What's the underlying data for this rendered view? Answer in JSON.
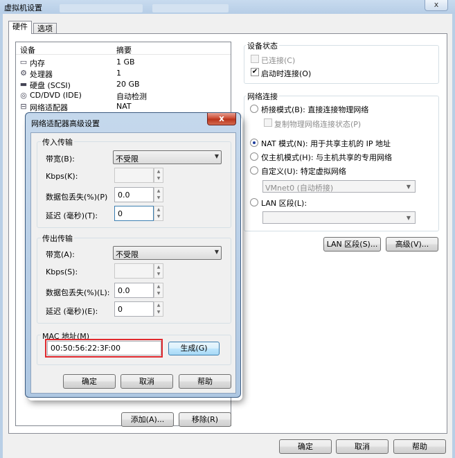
{
  "window": {
    "title": "虚拟机设置",
    "close_label": "x"
  },
  "tabs": [
    {
      "label": "硬件"
    },
    {
      "label": "选项"
    }
  ],
  "device_list": {
    "headers": {
      "device": "设备",
      "summary": "摘要"
    },
    "rows": [
      {
        "icon": "memory-icon",
        "name": "内存",
        "summary": "1 GB"
      },
      {
        "icon": "cpu-icon",
        "name": "处理器",
        "summary": "1"
      },
      {
        "icon": "disk-icon",
        "name": "硬盘 (SCSI)",
        "summary": "20 GB"
      },
      {
        "icon": "cdrom-icon",
        "name": "CD/DVD (IDE)",
        "summary": "自动检测"
      },
      {
        "icon": "network-icon",
        "name": "网络适配器",
        "summary": "NAT"
      }
    ]
  },
  "device_status": {
    "label": "设备状态",
    "connected": {
      "label": "已连接(C)",
      "checked": false,
      "enabled": false
    },
    "connect_at_power_on": {
      "label": "启动时连接(O)",
      "checked": true
    }
  },
  "network_connection": {
    "label": "网络连接",
    "bridged": {
      "label": "桥接模式(B): 直接连接物理网络",
      "selected": false
    },
    "replicate": {
      "label": "复制物理网络连接状态(P)",
      "checked": false,
      "enabled": false
    },
    "nat": {
      "label": "NAT 模式(N): 用于共享主机的 IP 地址",
      "selected": true
    },
    "host_only": {
      "label": "仅主机模式(H): 与主机共享的专用网络",
      "selected": false
    },
    "custom": {
      "label": "自定义(U): 特定虚拟网络",
      "selected": false
    },
    "custom_select": "VMnet0 (自动桥接)",
    "lan_segment": {
      "label": "LAN 区段(L):",
      "selected": false
    },
    "lan_select": ""
  },
  "right_buttons": {
    "lan_segments": "LAN 区段(S)...",
    "advanced": "高级(V)..."
  },
  "list_buttons": {
    "add": "添加(A)...",
    "remove": "移除(R)"
  },
  "bottom_buttons": {
    "ok": "确定",
    "cancel": "取消",
    "help": "帮助"
  },
  "dialog": {
    "title": "网络适配器高级设置",
    "close_label": "x",
    "incoming": {
      "label": "传入传输",
      "bandwidth_label": "带宽(B):",
      "bandwidth_value": "不受限",
      "kbps_label": "Kbps(K):",
      "kbps_value": "",
      "loss_label": "数据包丢失(%)(P)",
      "loss_value": "0.0",
      "latency_label": "延迟 (毫秒)(T):",
      "latency_value": "0"
    },
    "outgoing": {
      "label": "传出传输",
      "bandwidth_label": "带宽(A):",
      "bandwidth_value": "不受限",
      "kbps_label": "Kbps(S):",
      "kbps_value": "",
      "loss_label": "数据包丢失(%)(L):",
      "loss_value": "0.0",
      "latency_label": "延迟 (毫秒)(E):",
      "latency_value": "0"
    },
    "mac": {
      "label": "MAC 地址(M)",
      "value": "00:50:56:22:3F:00",
      "generate": "生成(G)"
    },
    "buttons": {
      "ok": "确定",
      "cancel": "取消",
      "help": "帮助"
    }
  },
  "colors": {
    "highlight_box": "#e0282d",
    "window_frame": "#b9cfe6",
    "dialog_close": "#c8442c"
  }
}
